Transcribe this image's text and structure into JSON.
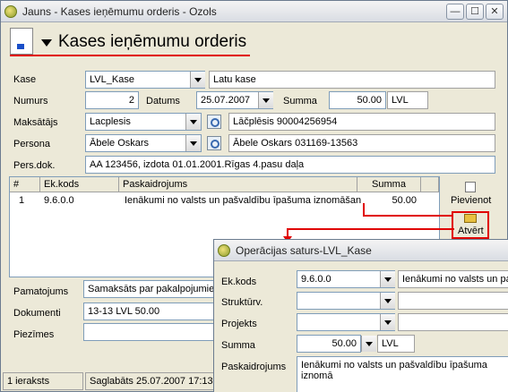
{
  "window": {
    "title": "Jauns - Kases ieņēmumu orderis - Ozols",
    "min": "—",
    "max": "☐",
    "close": "✕"
  },
  "header": {
    "title": "Kases ieņēmumu orderis"
  },
  "form": {
    "kase_label": "Kase",
    "kase_value": "LVL_Kase",
    "kase_name": "Latu kase",
    "numurs_label": "Numurs",
    "numurs_value": "2",
    "datums_label": "Datums",
    "datums_value": "25.07.2007",
    "summa_label": "Summa",
    "summa_value": "50.00",
    "summa_currency": "LVL",
    "maksatajs_label": "Maksātājs",
    "maksatajs_value": "Lacplesis",
    "maksatajs_full": "Lāčplēsis 90004256954",
    "persona_label": "Persona",
    "persona_value": "Ābele Oskars",
    "persona_full": "Ābele Oskars 031169-13563",
    "persdok_label": "Pers.dok.",
    "persdok_value": "AA 123456, izdota 01.01.2001.Rīgas 4.pasu daļa"
  },
  "grid": {
    "headers": [
      "#",
      "Ek.kods",
      "Paskaidrojums",
      "Summa"
    ],
    "rows": [
      [
        "1",
        "9.6.0.0",
        "Ienākumi no valsts un pašvaldību īpašuma iznomāšan",
        "50.00"
      ]
    ]
  },
  "side_buttons": {
    "add": "Pievienot",
    "open": "Atvērt"
  },
  "bottom": {
    "pamatojums_label": "Pamatojums",
    "pamatojums_value": "Samaksāts par pakalpojumiem",
    "dokumenti_label": "Dokumenti",
    "dokumenti_value": "13-13 LVL 50.00",
    "piezimes_label": "Piezīmes",
    "piezimes_value": ""
  },
  "status": {
    "count": "1 ieraksts",
    "saved": "Saglabāts 25.07.2007 17:13"
  },
  "popup": {
    "title": "Operācijas saturs-LVL_Kase",
    "ekkods_label": "Ek.kods",
    "ekkods_value": "9.6.0.0",
    "ekkods_name": "Ienākumi no valsts un pa",
    "struktv_label": "Struktūrv.",
    "projekts_label": "Projekts",
    "summa_label": "Summa",
    "summa_value": "50.00",
    "summa_currency": "LVL",
    "paskaid_label": "Paskaidrojums",
    "paskaid_value": "Ienākumi no valsts un pašvaldību īpašuma iznomā"
  },
  "colors": {
    "highlight": "#e00000",
    "window_bg": "#ece9d8"
  }
}
